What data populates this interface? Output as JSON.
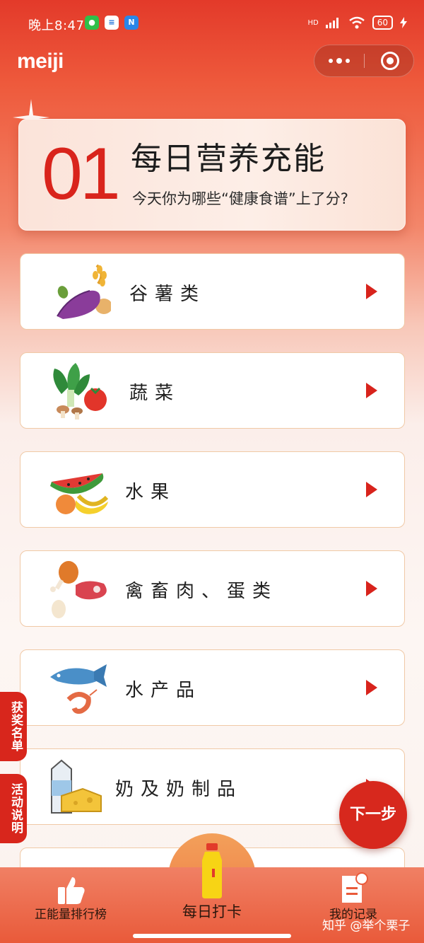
{
  "status_bar": {
    "time": "晚上8:47",
    "apps": [
      "wechat-icon",
      "yue-icon",
      "n-icon"
    ],
    "network": "HD",
    "battery": "60"
  },
  "header": {
    "logo": "meiji",
    "capsule_icons": [
      "more-icon",
      "close-target-icon"
    ]
  },
  "hero": {
    "number": "01",
    "title": "每日营养充能",
    "subtitle": "今天你为哪些“健康食谱”上了分?"
  },
  "categories": [
    {
      "label": "谷薯类",
      "icon": "grain-potato-icon"
    },
    {
      "label": "蔬菜",
      "icon": "vegetable-icon"
    },
    {
      "label": "水果",
      "icon": "fruit-icon"
    },
    {
      "label": "禽畜肉、蛋类",
      "icon": "meat-egg-icon"
    },
    {
      "label": "水产品",
      "icon": "seafood-icon"
    },
    {
      "label": "奶及奶制品",
      "icon": "dairy-icon"
    }
  ],
  "side_tabs": {
    "winners": "获奖名单",
    "rules": "活动说明"
  },
  "next_button": "下一步",
  "bottom_nav": {
    "rank": "正能量排行榜",
    "daily": "每日打卡",
    "records": "我的记录"
  },
  "watermark": "知乎 @举个栗子",
  "colors": {
    "accent_red": "#d8231c",
    "card_border": "#f0c9a6",
    "nav_bg": "#e95a3a"
  }
}
